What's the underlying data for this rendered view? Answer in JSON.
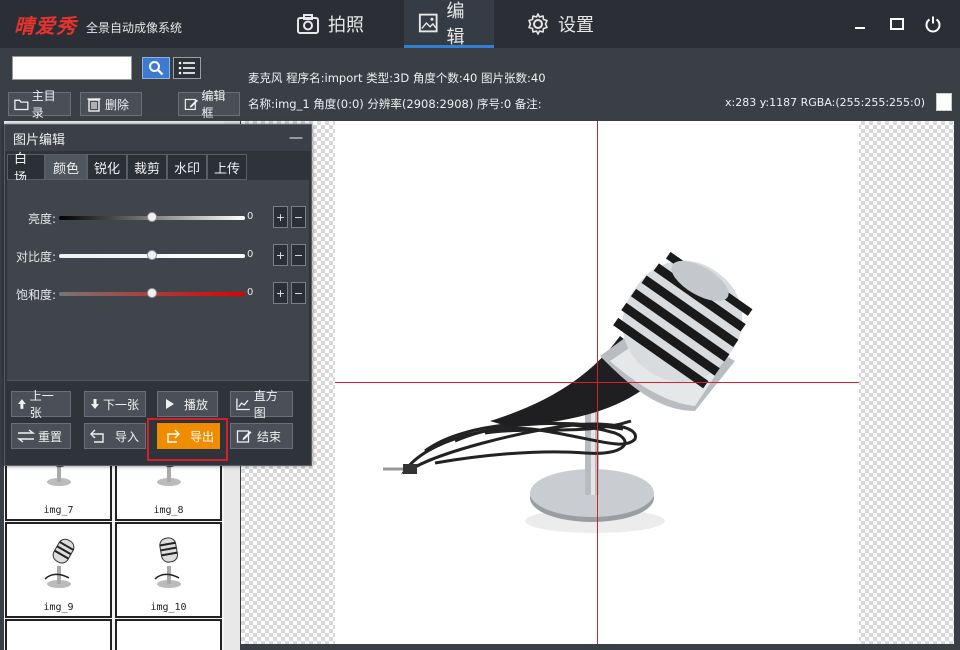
{
  "app": {
    "logo": "晴爱秀",
    "subtitle": "全景自动成像系统"
  },
  "nav": [
    {
      "label": "拍照",
      "icon": "camera-icon"
    },
    {
      "label": "编辑",
      "icon": "image-icon",
      "active": true
    },
    {
      "label": "设置",
      "icon": "gear-icon"
    }
  ],
  "toolbar": {
    "search_value": "",
    "home_label": "主目录",
    "delete_label": "删除",
    "editframe_label": "编辑框"
  },
  "info": {
    "line1": "麦克风 程序名:import 类型:3D 角度个数:40 图片张数:40",
    "line2": "名称:img_1 角度(0:0) 分辨率(2908:2908) 序号:0 备注:",
    "coords": "x:283 y:1187 RGBA:(255:255:255:0)"
  },
  "panel": {
    "title": "图片编辑",
    "collapse": "—",
    "tabs": [
      "白场",
      "颜色",
      "锐化",
      "裁剪",
      "水印",
      "上传"
    ],
    "sliders": [
      {
        "label": "亮度:",
        "value": "0",
        "level": 0.5
      },
      {
        "label": "对比度:",
        "value": "0",
        "level": 0.5
      },
      {
        "label": "饱和度:",
        "value": "0",
        "level": 0.5
      }
    ],
    "plus": "+",
    "minus": "−",
    "buttons": {
      "prev": "上一张",
      "next": "下一张",
      "play": "播放",
      "histogram": "直方图",
      "reset": "重置",
      "import": "导入",
      "export": "导出",
      "finish": "结束"
    }
  },
  "thumbnails": [
    "img_7",
    "img_8",
    "img_9",
    "img_10"
  ],
  "colors": {
    "accent": "#2f7fd2",
    "export": "#f08c00",
    "crosshair": "#d4202a"
  }
}
